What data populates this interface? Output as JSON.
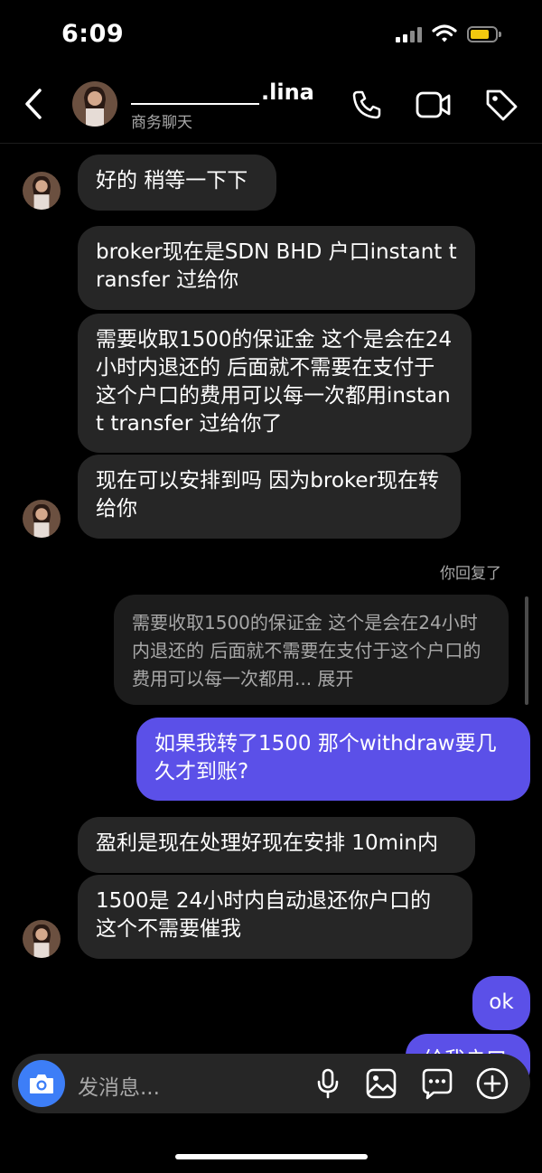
{
  "status_bar": {
    "time": "6:09"
  },
  "header": {
    "contact_name": ".lina",
    "subtitle": "商务聊天"
  },
  "messages": {
    "m1": "好的 稍等一下下",
    "m2": "broker现在是SDN BHD 户口instant transfer 过给你",
    "m3": "需要收取1500的保证金 这个是会在24小时内退还的  后面就不需要在支付于这个户口的费用可以每一次都用instant transfer 过给你了",
    "m4": "现在可以安排到吗 因为broker现在转给你",
    "reply_label": "你回复了",
    "reply_quote": "需要收取1500的保证金 这个是会在24小时内退还的  后面就不需要在支付于这个户口的费用可以每一次都用... 展开",
    "m5": "如果我转了1500 那个withdraw要几久才到账?",
    "m6": "盈利是现在处理好现在安排 10min内",
    "m7": "1500是 24小时内自动退还你户口的 这个不需要催我",
    "m8": "ok",
    "m9_partial": "给我户口"
  },
  "composer": {
    "placeholder": "发消息..."
  },
  "icons": {
    "back": "chevron-left-icon",
    "call": "phone-icon",
    "video": "video-camera-icon",
    "tag": "tag-icon",
    "camera": "camera-icon",
    "mic": "microphone-icon",
    "gallery": "image-icon",
    "sticker": "chat-bubble-icon",
    "add": "plus-circle-icon"
  },
  "colors": {
    "background": "#000000",
    "incoming_bubble": "#262626",
    "outgoing_bubble": "#5b50e8",
    "camera_button": "#3d7ef7",
    "battery": "#f2c80f"
  }
}
